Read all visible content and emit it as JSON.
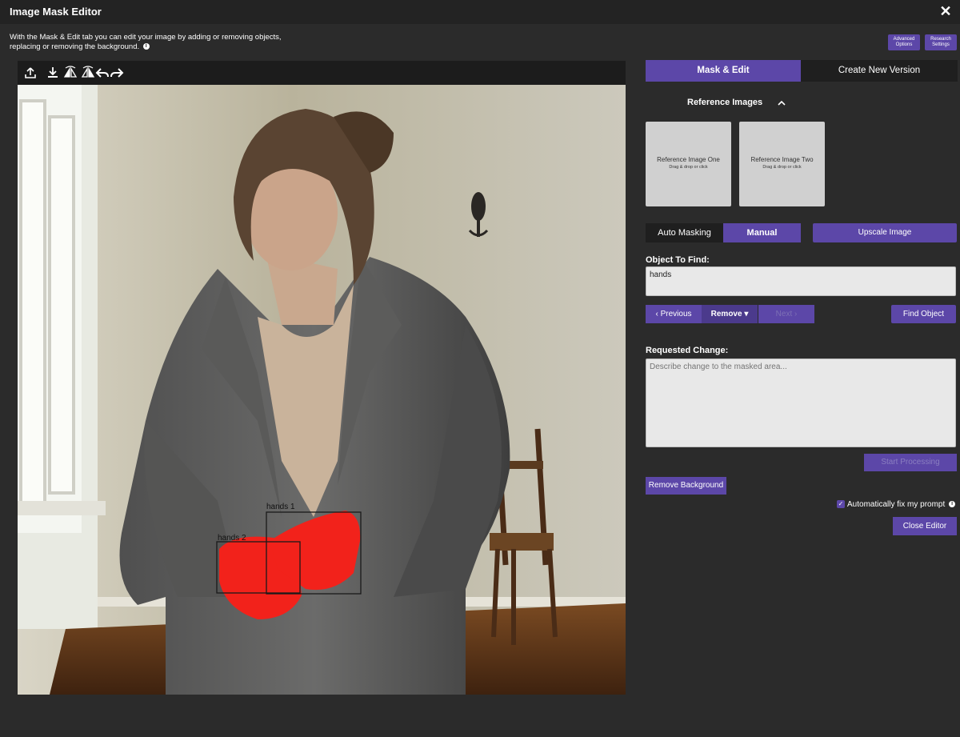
{
  "window": {
    "title": "Image Mask Editor",
    "intro_text": "With the Mask & Edit tab you can edit your image by adding or removing objects, replacing or removing the background."
  },
  "header_buttons": {
    "advanced_line1": "Advanced",
    "advanced_line2": "Options",
    "research_line1": "Research",
    "research_line2": "Settings"
  },
  "toolbar": {
    "icons": [
      "upload-icon",
      "download-icon",
      "flip-horizontal-icon",
      "flip-vertical-icon",
      "undo-icon",
      "redo-icon"
    ]
  },
  "canvas": {
    "detections": [
      {
        "label": "hands 1"
      },
      {
        "label": "hands 2"
      }
    ],
    "mask_color": "#f2221b"
  },
  "tabs": [
    {
      "label": "Mask & Edit",
      "active": true
    },
    {
      "label": "Create New Version",
      "active": false
    }
  ],
  "reference": {
    "title": "Reference Images",
    "boxes": [
      {
        "label": "Reference Image One",
        "hint": "Drag & drop or click"
      },
      {
        "label": "Reference Image Two",
        "hint": "Drag & drop or click"
      }
    ]
  },
  "masking": {
    "auto_label": "Auto Masking",
    "manual_label": "Manual",
    "upscale_label": "Upscale Image"
  },
  "object_find": {
    "label": "Object To Find:",
    "value": "hands",
    "prev_label": "‹ Previous",
    "remove_label": "Remove ▾",
    "next_label": "Next ›",
    "find_label": "Find Object"
  },
  "requested_change": {
    "label": "Requested Change:",
    "placeholder": "Describe change to the masked area..."
  },
  "actions": {
    "start_label": "Start Processing",
    "remove_bg_label": "Remove Background",
    "auto_fix_label": "Automatically fix my prompt",
    "auto_fix_checked": true,
    "close_label": "Close Editor"
  },
  "colors": {
    "accent": "#5c47a8",
    "background": "#2b2b2b",
    "titlebar": "#232323"
  }
}
